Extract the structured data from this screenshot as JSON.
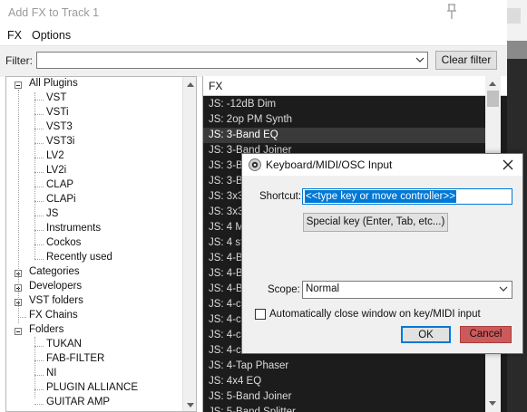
{
  "window": {
    "title": "Add FX to Track 1"
  },
  "menu": [
    "FX",
    "Options"
  ],
  "filter": {
    "label": "Filter:",
    "value": "",
    "clear_label": "Clear filter"
  },
  "tree": {
    "items": [
      {
        "label": "All Plugins",
        "level": 0,
        "expander": "minus"
      },
      {
        "label": "VST",
        "level": 1
      },
      {
        "label": "VSTi",
        "level": 1
      },
      {
        "label": "VST3",
        "level": 1
      },
      {
        "label": "VST3i",
        "level": 1
      },
      {
        "label": "LV2",
        "level": 1
      },
      {
        "label": "LV2i",
        "level": 1
      },
      {
        "label": "CLAP",
        "level": 1
      },
      {
        "label": "CLAPi",
        "level": 1
      },
      {
        "label": "JS",
        "level": 1
      },
      {
        "label": "Instruments",
        "level": 1
      },
      {
        "label": "Cockos",
        "level": 1
      },
      {
        "label": "Recently used",
        "level": 1
      },
      {
        "label": "Categories",
        "level": 0,
        "expander": "plus"
      },
      {
        "label": "Developers",
        "level": 0,
        "expander": "plus"
      },
      {
        "label": "VST folders",
        "level": 0,
        "expander": "plus"
      },
      {
        "label": "FX Chains",
        "level": 0
      },
      {
        "label": "Folders",
        "level": 0,
        "expander": "minus"
      },
      {
        "label": "TUKAN",
        "level": 1
      },
      {
        "label": "FAB-FILTER",
        "level": 1
      },
      {
        "label": "NI",
        "level": 1
      },
      {
        "label": "PLUGIN ALLIANCE",
        "level": 1
      },
      {
        "label": "GUITAR AMP",
        "level": 1
      }
    ]
  },
  "fx": {
    "header": "FX",
    "rows": [
      "JS: -12dB Dim",
      "JS: 2op PM Synth",
      "JS: 3-Band EQ",
      "JS: 3-Band Joiner",
      "JS: 3-Ba",
      "JS: 3-Ba",
      "JS: 3x3",
      "JS: 3x3",
      "JS: 4 Mo",
      "JS: 4 ste",
      "JS: 4-Ba",
      "JS: 4-Ba",
      "JS: 4-Ba",
      "JS: 4-ch",
      "JS: 4-ch",
      "JS: 4-ch",
      "JS: 4-ch",
      "JS: 4-Tap Phaser",
      "JS: 4x4 EQ",
      "JS: 5-Band Joiner",
      "JS: 5-Band Splitter"
    ],
    "selected_index": 2
  },
  "dialog": {
    "title": "Keyboard/MIDI/OSC Input",
    "shortcut_label": "Shortcut:",
    "shortcut_value": "<<type key or move controller>>",
    "special_key_label": "Special key (Enter, Tab, etc...)",
    "scope_label": "Scope:",
    "scope_value": "Normal",
    "auto_close_label": "Automatically close window on key/MIDI input",
    "auto_close_checked": false,
    "ok_label": "OK",
    "cancel_label": "Cancel"
  },
  "colors": {
    "selection": "#0078d7",
    "cancel_bg": "#cd5a5a",
    "list_bg": "#1c1c1c",
    "list_text": "#dcdcdc"
  }
}
